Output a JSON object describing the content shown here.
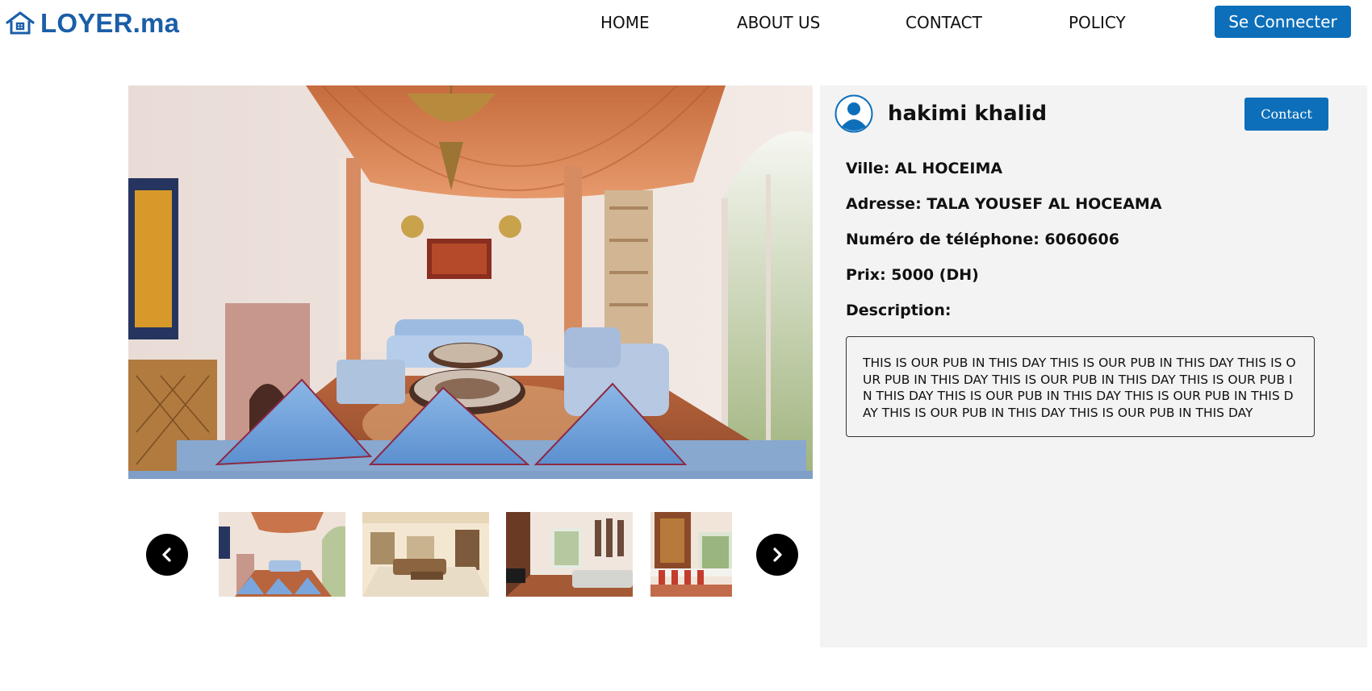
{
  "header": {
    "logo_text": "LOYER.ma",
    "nav": [
      {
        "label": "HOME"
      },
      {
        "label": "ABOUT US"
      },
      {
        "label": "CONTACT"
      },
      {
        "label": "POLICY"
      }
    ],
    "login_label": "Se Connecter"
  },
  "owner": {
    "name": "hakimi khalid",
    "contact_label": "Contact"
  },
  "listing": {
    "ville": "Ville: AL HOCEIMA",
    "adresse": "Adresse: TALA YOUSEF AL HOCEAMA",
    "telephone": "Numéro de téléphone: 6060606",
    "prix": "Prix: 5000 (DH)",
    "description_label": "Description:",
    "description": "THIS IS OUR PUB IN THIS DAY THIS IS OUR PUB IN THIS DAY THIS IS OUR PUB IN THIS DAY THIS IS OUR PUB IN THIS DAY THIS IS OUR PUB IN THIS DAY THIS IS OUR PUB IN THIS DAY THIS IS OUR PUB IN THIS DAY THIS IS OUR PUB IN THIS DAY THIS IS OUR PUB IN THIS DAY"
  },
  "icons": {
    "logo": "house-icon",
    "avatar": "user-avatar-icon",
    "prev": "chevron-left-icon",
    "next": "chevron-right-icon"
  },
  "colors": {
    "brand": "#1b5ea8",
    "button": "#0d6fb9",
    "panel": "#f3f3f3"
  }
}
